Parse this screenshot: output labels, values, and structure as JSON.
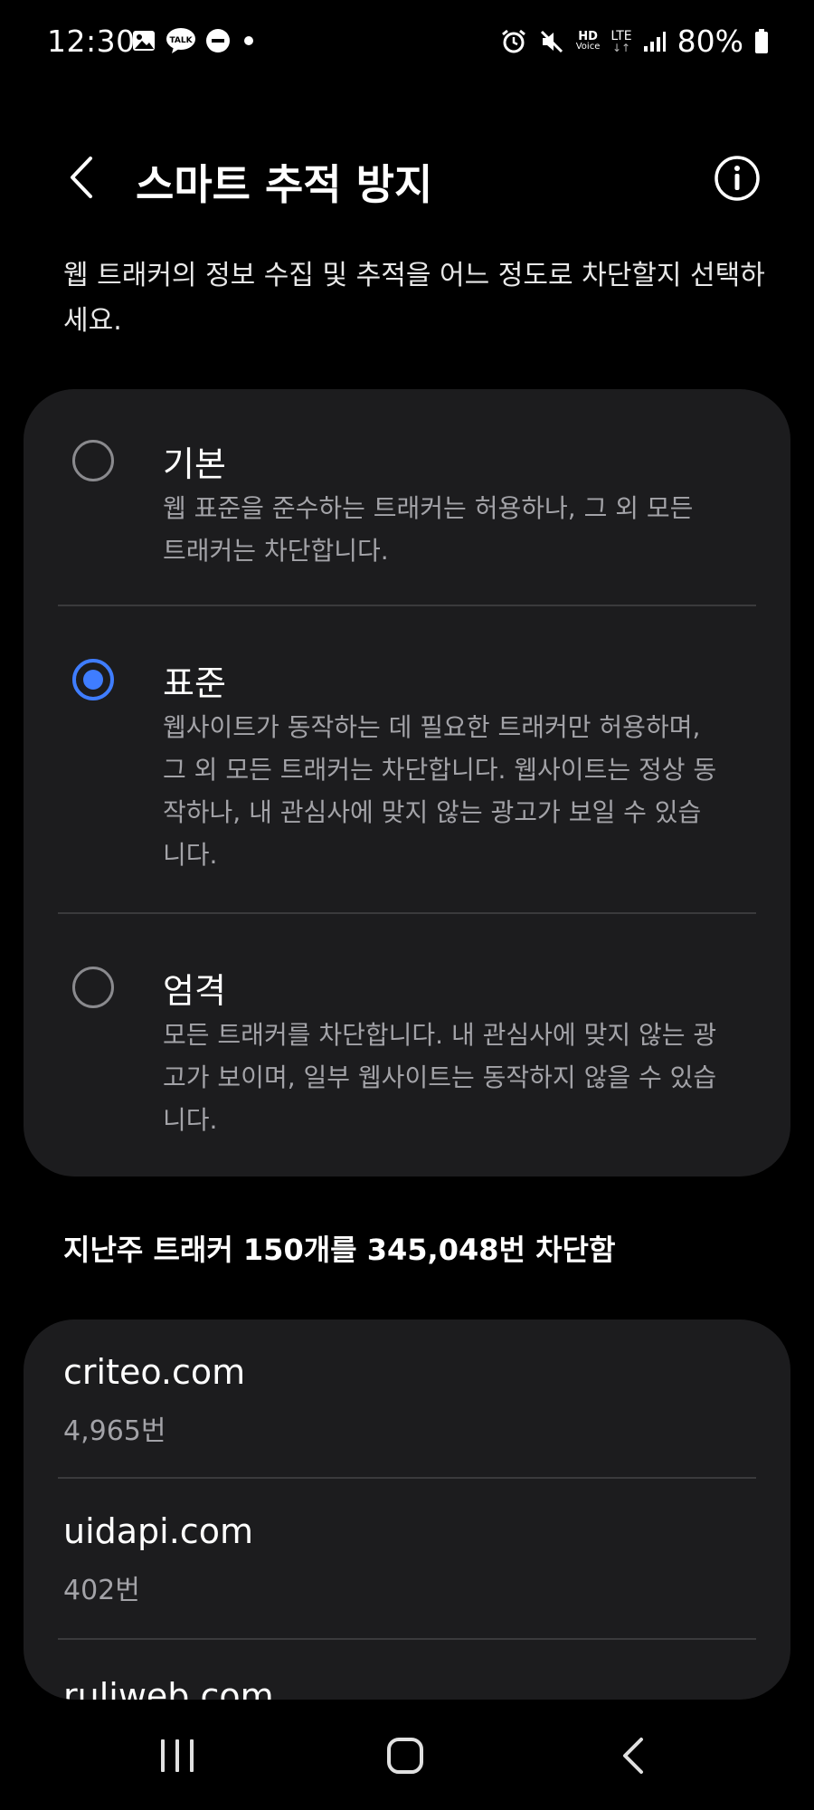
{
  "status_bar": {
    "time": "12:30",
    "battery": "80%",
    "hd_voice_top": "HD",
    "hd_voice_bottom": "Voice",
    "lte": "LTE",
    "talk": "TALK",
    "left_icons": [
      "gallery-icon",
      "talk-icon",
      "dnd-icon",
      "dot-icon"
    ],
    "right_icons": [
      "alarm-icon",
      "mute-icon",
      "hd-voice-icon",
      "lte-icon",
      "signal-icon",
      "battery-icon"
    ]
  },
  "header": {
    "title": "스마트 추적 방지"
  },
  "description": "웹 트래커의 정보 수집 및 추적을 어느 정도로 차단할지 선택하세요.",
  "options": [
    {
      "title": "기본",
      "description": "웹 표준을 준수하는 트래커는 허용하나, 그 외 모든 트래커는 차단합니다.",
      "selected": false
    },
    {
      "title": "표준",
      "description": "웹사이트가 동작하는 데 필요한 트래커만 허용하며, 그 외 모든 트래커는 차단합니다. 웹사이트는 정상 동작하나, 내 관심사에 맞지 않는 광고가 보일 수 있습니다.",
      "selected": true
    },
    {
      "title": "엄격",
      "description": "모든 트래커를 차단합니다. 내 관심사에 맞지 않는 광고가 보이며, 일부 웹사이트는 동작하지 않을 수 있습니다.",
      "selected": false
    }
  ],
  "summary": "지난주 트래커 150개를 345,048번 차단함",
  "trackers": [
    {
      "domain": "criteo.com",
      "count": "4,965번"
    },
    {
      "domain": "uidapi.com",
      "count": "402번"
    },
    {
      "domain": "ruliweb.com",
      "count": ""
    }
  ],
  "colors": {
    "background": "#000000",
    "card": "#1c1c1e",
    "accent": "#3f7dff",
    "secondary_text": "#a3a3a8"
  }
}
